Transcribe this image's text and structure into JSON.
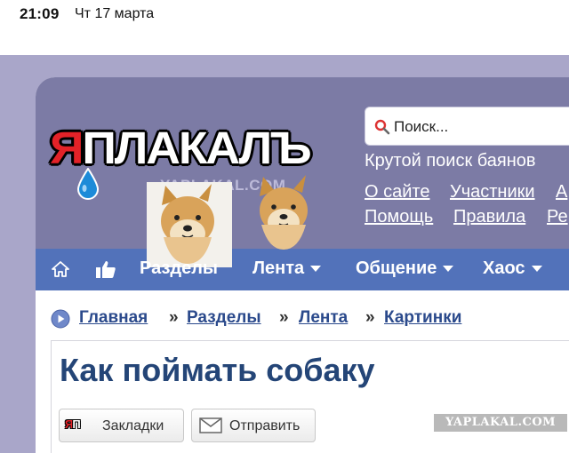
{
  "status_bar": {
    "time": "21:09",
    "date": "Чт 17 марта"
  },
  "site": {
    "logo": {
      "text_first": "Я",
      "text_rest": "ПЛАКАЛЪ",
      "watermark": "YAPLAKAL.COM"
    },
    "search": {
      "placeholder": "Поиск...",
      "tagline": "Крутой поиск баянов"
    },
    "top_links": [
      {
        "label": "О сайте"
      },
      {
        "label": "Участники"
      },
      {
        "label": "А"
      },
      {
        "label": "Помощь"
      },
      {
        "label": "Правила"
      },
      {
        "label": "Ре"
      }
    ],
    "nav": {
      "home_icon": "home-icon",
      "like_icon": "thumbs-up-icon",
      "items": [
        {
          "label": "Разделы",
          "has_caret": false
        },
        {
          "label": "Лента",
          "has_caret": true
        },
        {
          "label": "Общение",
          "has_caret": true
        },
        {
          "label": "Хаос",
          "has_caret": true
        }
      ]
    },
    "breadcrumbs": {
      "separator": "»",
      "items": [
        {
          "label": "Главная"
        },
        {
          "label": "Разделы"
        },
        {
          "label": "Лента"
        },
        {
          "label": "Картинки"
        }
      ]
    },
    "post": {
      "title": "Как поймать собаку",
      "buttons": {
        "bookmarks": "Закладки",
        "send": "Отправить"
      },
      "bookmark_badge": {
        "first": "Я",
        "rest": "П"
      },
      "image_watermark": "YAPLAKAL.COM"
    },
    "colors": {
      "header_bg": "#7c7ba5",
      "nav_bg": "#5272ba",
      "logo_red": "#e32228",
      "title_blue": "#244577",
      "link_blue": "#2b4a8c"
    }
  }
}
